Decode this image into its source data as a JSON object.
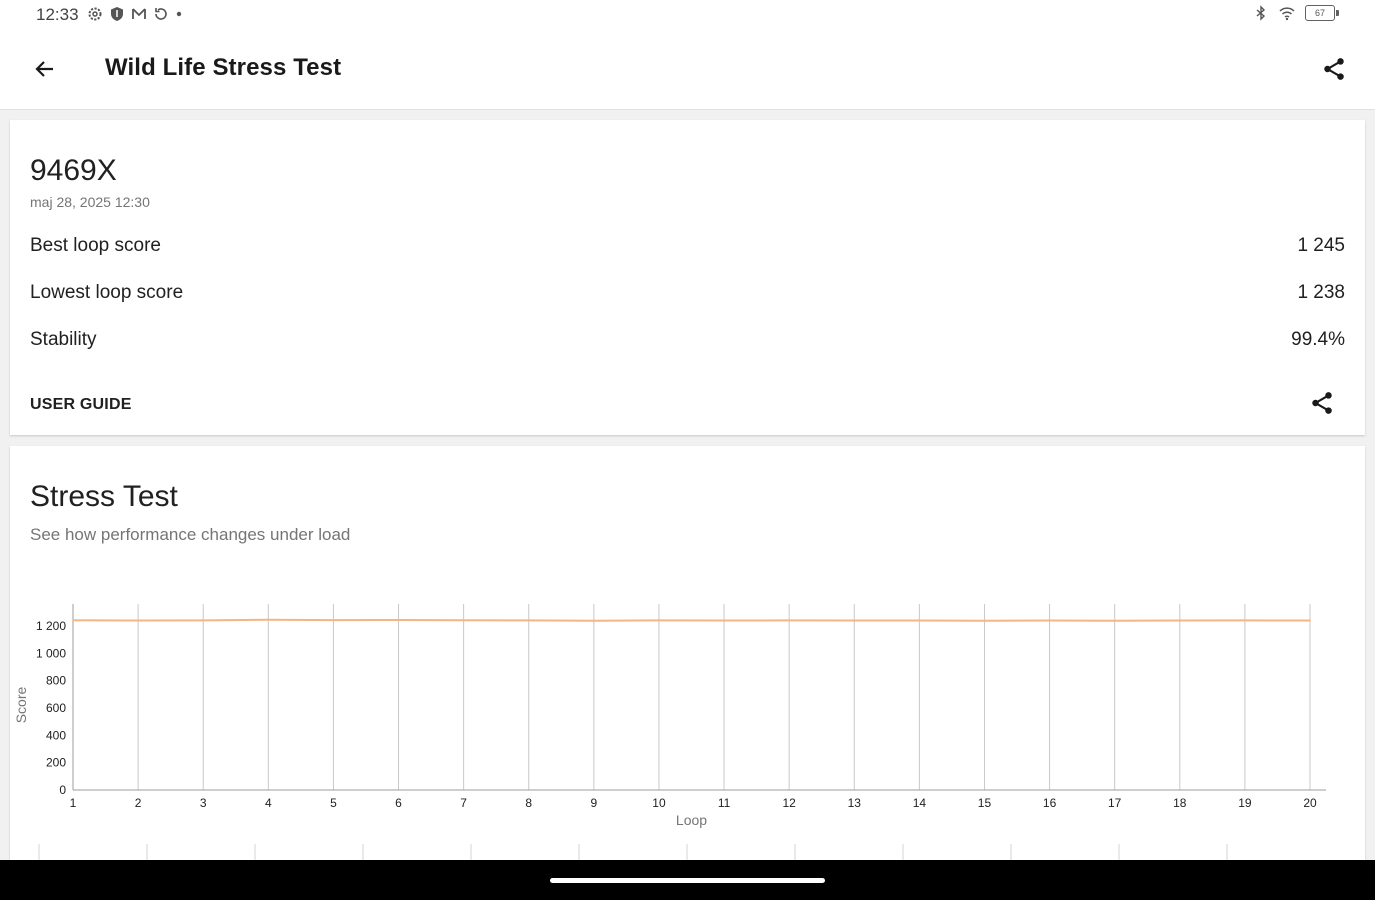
{
  "status_bar": {
    "time": "12:33",
    "icons_left": [
      "settings-icon",
      "shield-icon",
      "gmail-icon",
      "sync-icon",
      "dot-icon"
    ],
    "icons_right": [
      "bluetooth-icon",
      "wifi-icon",
      "battery-icon"
    ],
    "battery_level": "67"
  },
  "app_bar": {
    "title": "Wild Life Stress Test",
    "back_icon": "arrow-back-icon",
    "share_icon": "share-icon"
  },
  "result_card": {
    "score": "9469X",
    "date": "maj 28, 2025 12:30",
    "rows": [
      {
        "label": "Best loop score",
        "value": "1 245"
      },
      {
        "label": "Lowest loop score",
        "value": "1 238"
      },
      {
        "label": "Stability",
        "value": "99.4%"
      }
    ],
    "user_guide": "USER GUIDE"
  },
  "stress_card": {
    "title": "Stress Test",
    "subtitle": "See how performance changes under load"
  },
  "colors": {
    "line": "#f5b57f",
    "grid": "#c8c8c8",
    "axis": "#9e9e9e"
  },
  "chart_data": {
    "type": "line",
    "xlabel": "Loop",
    "ylabel": "Score",
    "x": [
      1,
      2,
      3,
      4,
      5,
      6,
      7,
      8,
      9,
      10,
      11,
      12,
      13,
      14,
      15,
      16,
      17,
      18,
      19,
      20
    ],
    "y_tick_values": [
      0,
      200,
      400,
      600,
      800,
      1000,
      1200
    ],
    "y_tick_labels": [
      "0",
      "200",
      "400",
      "600",
      "800",
      "1 000",
      "1 200"
    ],
    "x_tick_labels": [
      "1",
      "2",
      "3",
      "4",
      "5",
      "6",
      "7",
      "8",
      "9",
      "10",
      "11",
      "12",
      "13",
      "14",
      "15",
      "16",
      "17",
      "18",
      "19",
      "20"
    ],
    "ylim": [
      0,
      1250
    ],
    "series": [
      {
        "values": [
          1242,
          1240,
          1241,
          1245,
          1243,
          1244,
          1242,
          1241,
          1239,
          1241,
          1240,
          1241,
          1240,
          1240,
          1239,
          1240,
          1238,
          1240,
          1241,
          1240
        ]
      }
    ],
    "grid": "vertical"
  }
}
